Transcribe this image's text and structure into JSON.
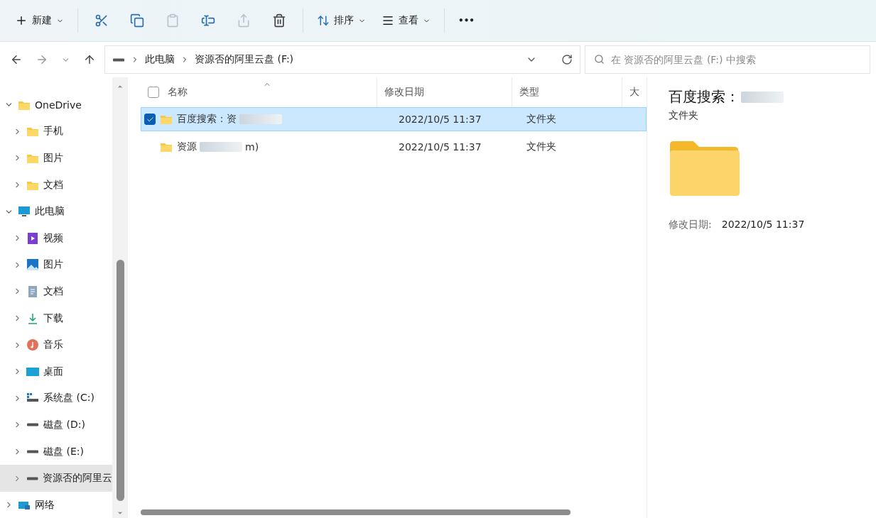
{
  "toolbar": {
    "new_label": "新建",
    "sort_label": "排序",
    "view_label": "查看",
    "more": "•••",
    "actions": [
      {
        "kind": "cut",
        "disabled": false
      },
      {
        "kind": "copy",
        "disabled": false
      },
      {
        "kind": "paste",
        "disabled": true
      },
      {
        "kind": "rename",
        "disabled": false
      },
      {
        "kind": "share",
        "disabled": true
      },
      {
        "kind": "delete",
        "disabled": false
      }
    ]
  },
  "address": {
    "crumbs": [
      "此电脑",
      "资源否的阿里云盘 (F:)"
    ],
    "search_placeholder": "在 资源否的阿里云盘 (F:) 中搜索"
  },
  "sidebar": {
    "items": [
      {
        "label": "OneDrive",
        "kind": "folder",
        "expanded": true,
        "selected": false,
        "children": [
          {
            "label": "手机",
            "kind": "folder",
            "expanded": false,
            "selected": false
          },
          {
            "label": "图片",
            "kind": "folder",
            "expanded": false,
            "selected": false
          },
          {
            "label": "文档",
            "kind": "folder",
            "expanded": false,
            "selected": false
          }
        ]
      },
      {
        "label": "此电脑",
        "kind": "pc",
        "expanded": true,
        "selected": false,
        "children": [
          {
            "label": "视频",
            "kind": "video",
            "expanded": false,
            "selected": false
          },
          {
            "label": "图片",
            "kind": "image",
            "expanded": false,
            "selected": false
          },
          {
            "label": "文档",
            "kind": "doc",
            "expanded": false,
            "selected": false
          },
          {
            "label": "下载",
            "kind": "download",
            "expanded": false,
            "selected": false
          },
          {
            "label": "音乐",
            "kind": "music",
            "expanded": false,
            "selected": false
          },
          {
            "label": "桌面",
            "kind": "desktop",
            "expanded": false,
            "selected": false
          },
          {
            "label": "系统盘 (C:)",
            "kind": "sysdrive",
            "expanded": false,
            "selected": false
          },
          {
            "label": "磁盘 (D:)",
            "kind": "drive",
            "expanded": false,
            "selected": false
          },
          {
            "label": "磁盘 (E:)",
            "kind": "drive",
            "expanded": false,
            "selected": false
          },
          {
            "label": "资源否的阿里云",
            "kind": "drive",
            "expanded": false,
            "selected": true
          }
        ]
      },
      {
        "label": "网络",
        "kind": "network",
        "expanded": false,
        "selected": false
      }
    ]
  },
  "table": {
    "select_all_checked": false,
    "columns": [
      "名称",
      "修改日期",
      "类型",
      "大"
    ],
    "rows": [
      {
        "name_parts": [
          "百度搜索：资"
        ],
        "modified": "2022/10/5 11:37",
        "type": "文件夹",
        "selected": true,
        "checked": true
      },
      {
        "name_parts": [
          "资源",
          "m)"
        ],
        "modified": "2022/10/5 11:37",
        "type": "文件夹",
        "selected": false,
        "checked": false
      }
    ]
  },
  "details": {
    "title": "百度搜索：",
    "type": "文件夹",
    "modified_label": "修改日期:",
    "modified": "2022/10/5 11:37"
  }
}
